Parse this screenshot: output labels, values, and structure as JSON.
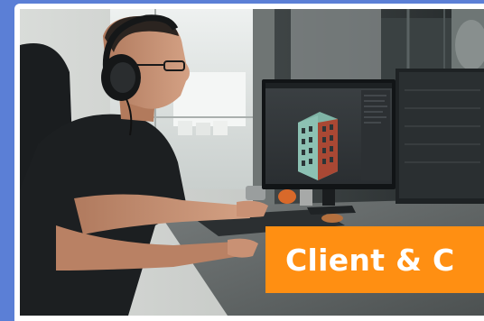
{
  "banner": {
    "text": "Client & C",
    "color": "#ff8f12",
    "text_color": "#ffffff"
  },
  "background_color": "#5b7fd6",
  "photo": {
    "subject": "person-with-headphones-at-computer-monitor"
  }
}
